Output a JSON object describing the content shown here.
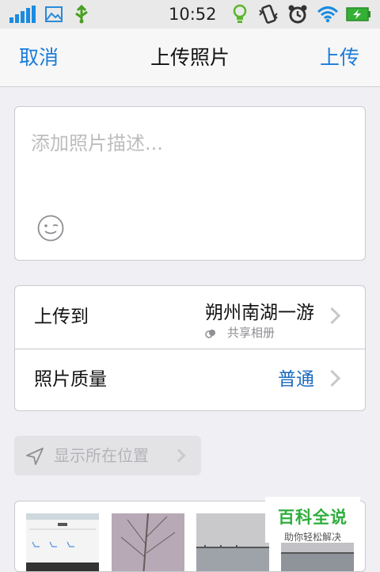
{
  "status_bar": {
    "time": "10:52",
    "icons": [
      "signal-icon",
      "image-icon",
      "usb-icon",
      "bulb-icon",
      "vibrate-icon",
      "alarm-icon",
      "wifi-icon",
      "battery-icon"
    ],
    "colors": {
      "signal": "#1a8be0",
      "usb": "#46a020",
      "battery": "#35b035"
    }
  },
  "nav": {
    "cancel_label": "取消",
    "title": "上传照片",
    "upload_label": "上传"
  },
  "description": {
    "placeholder": "添加照片描述..."
  },
  "options": {
    "upload_to": {
      "label": "上传到",
      "album": "朔州南湖一游",
      "album_type": "共享相册"
    },
    "quality": {
      "label": "照片质量",
      "value": "普通"
    }
  },
  "location": {
    "label": "显示所在位置"
  },
  "watermark": {
    "title": "百科全说",
    "subtitle": "助你轻松解决"
  },
  "colors": {
    "accent": "#1b7bd8",
    "background": "#efeff4"
  }
}
